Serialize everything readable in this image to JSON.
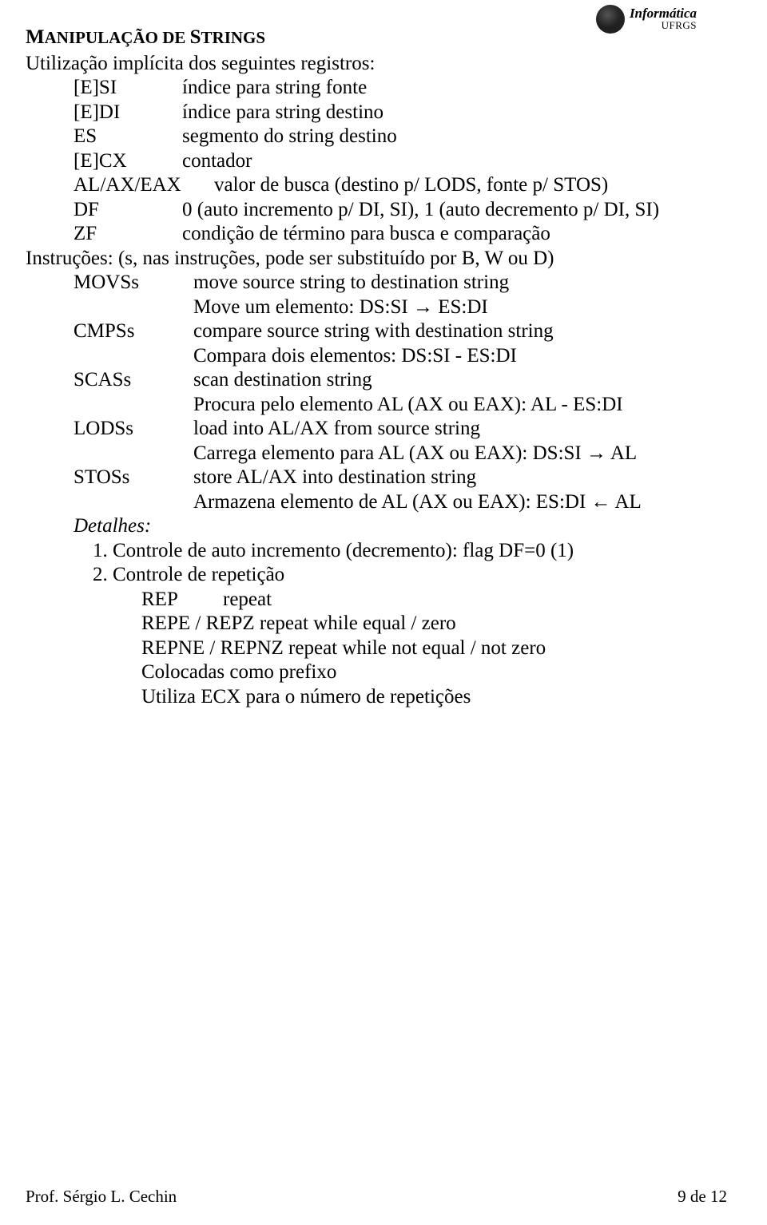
{
  "logo": {
    "title": "Informática",
    "sub": "UFRGS"
  },
  "heading_pre": "M",
  "heading_sc": "ANIPULAÇÃO DE ",
  "heading_pre2": "S",
  "heading_sc2": "TRINGS",
  "intro": "Utilização implícita dos seguintes registros:",
  "regs": {
    "esi": "[E]SI",
    "esi_d": "índice para string fonte",
    "edi": "[E]DI",
    "edi_d": "índice para string destino",
    "es": "ES",
    "es_d": "segmento do string destino",
    "ecx": "[E]CX",
    "ecx_d": "contador",
    "eax": "AL/AX/EAX",
    "eax_d": "valor de busca (destino p/ LODS, fonte p/ STOS)",
    "df": "DF",
    "df_d": "0 (auto incremento p/ DI, SI), 1 (auto decremento p/ DI, SI)",
    "zf": "ZF",
    "zf_d": "condição de término para busca e comparação"
  },
  "instr_intro": "Instruções: (s, nas instruções, pode ser substituído por B, W ou D)",
  "instr": {
    "movs": "MOVSs",
    "movs_d": "move source string to destination string",
    "movs_l2": "Move um elemento: DS:SI → ES:DI",
    "cmps": "CMPSs",
    "cmps_d": "compare source string with destination string",
    "cmps_l2": "Compara dois elementos: DS:SI - ES:DI",
    "scas": "SCASs",
    "scas_d": "scan destination string",
    "scas_l2": "Procura pelo elemento AL (AX ou EAX): AL - ES:DI",
    "lods": "LODSs",
    "lods_d": "load into AL/AX from source string",
    "lods_l2": "Carrega elemento para AL (AX ou EAX): DS:SI → AL",
    "stos": "STOSs",
    "stos_d": "store AL/AX into destination string",
    "stos_l2": "Armazena elemento de AL (AX ou EAX): ES:DI ← AL"
  },
  "details_label": "Detalhes:",
  "d1": "1. Controle de auto incremento (decremento): flag DF=0 (1)",
  "d2": "2. Controle de repetição",
  "rep": {
    "a": "REP",
    "b": "repeat"
  },
  "repe": "REPE / REPZ repeat while equal / zero",
  "repne": "REPNE / REPNZ    repeat while not equal / not zero",
  "d3a": "Colocadas como prefixo",
  "d3b": "Utiliza ECX para o número de repetições",
  "footer": {
    "left": "Prof. Sérgio L. Cechin",
    "right": "9 de 12"
  }
}
